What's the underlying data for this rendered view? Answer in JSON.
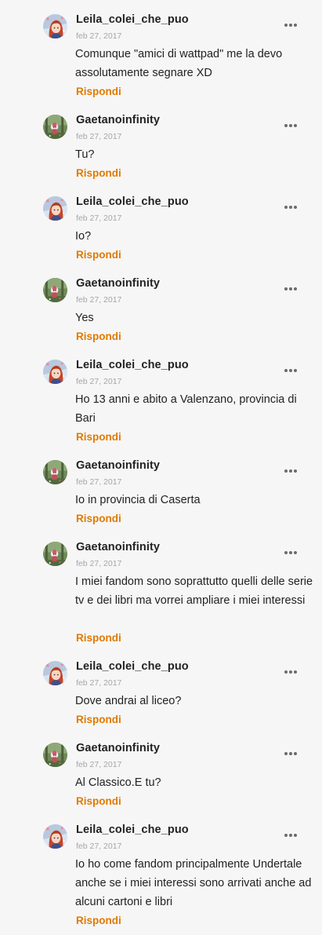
{
  "colors": {
    "background": "#f6f6f6",
    "username": "#222222",
    "date": "#a6a6a6",
    "reply": "#e07a00",
    "text": "#222222"
  },
  "comments": [
    {
      "user": "Leila_colei_che_puo",
      "date": "feb 27, 2017",
      "text": "Comunque \"amici di wattpad\" me la devo assolutamente segnare XD",
      "reply": "Rispondi",
      "avatar": "anime-girl-avatar"
    },
    {
      "user": "Gaetanoinfinity",
      "date": "feb 27, 2017",
      "text": "Tu?",
      "reply": "Rispondi",
      "avatar": "forest-avatar"
    },
    {
      "user": "Leila_colei_che_puo",
      "date": "feb 27, 2017",
      "text": "Io?",
      "reply": "Rispondi",
      "avatar": "anime-girl-avatar"
    },
    {
      "user": "Gaetanoinfinity",
      "date": "feb 27, 2017",
      "text": "Yes",
      "reply": "Rispondi",
      "avatar": "forest-avatar"
    },
    {
      "user": "Leila_colei_che_puo",
      "date": "feb 27, 2017",
      "text": "Ho 13 anni e abito a Valenzano, provincia di Bari",
      "reply": "Rispondi",
      "avatar": "anime-girl-avatar"
    },
    {
      "user": "Gaetanoinfinity",
      "date": "feb 27, 2017",
      "text": "Io in provincia di Caserta",
      "reply": "Rispondi",
      "avatar": "forest-avatar"
    },
    {
      "user": "Gaetanoinfinity",
      "date": "feb 27, 2017",
      "text": "I miei fandom sono soprattutto quelli delle serie tv e dei libri ma vorrei ampliare i miei interessi",
      "reply": "Rispondi",
      "avatar": "forest-avatar"
    },
    {
      "user": "Leila_colei_che_puo",
      "date": "feb 27, 2017",
      "text": "Dove andrai al liceo?",
      "reply": "Rispondi",
      "avatar": "anime-girl-avatar"
    },
    {
      "user": "Gaetanoinfinity",
      "date": "feb 27, 2017",
      "text": "Al Classico.E tu?",
      "reply": "Rispondi",
      "avatar": "forest-avatar"
    },
    {
      "user": "Leila_colei_che_puo",
      "date": "feb 27, 2017",
      "text": "Io ho come fandom principalmente Undertale anche se i miei interessi sono arrivati anche ad alcuni cartoni e libri",
      "reply": "Rispondi",
      "avatar": "anime-girl-avatar"
    }
  ]
}
